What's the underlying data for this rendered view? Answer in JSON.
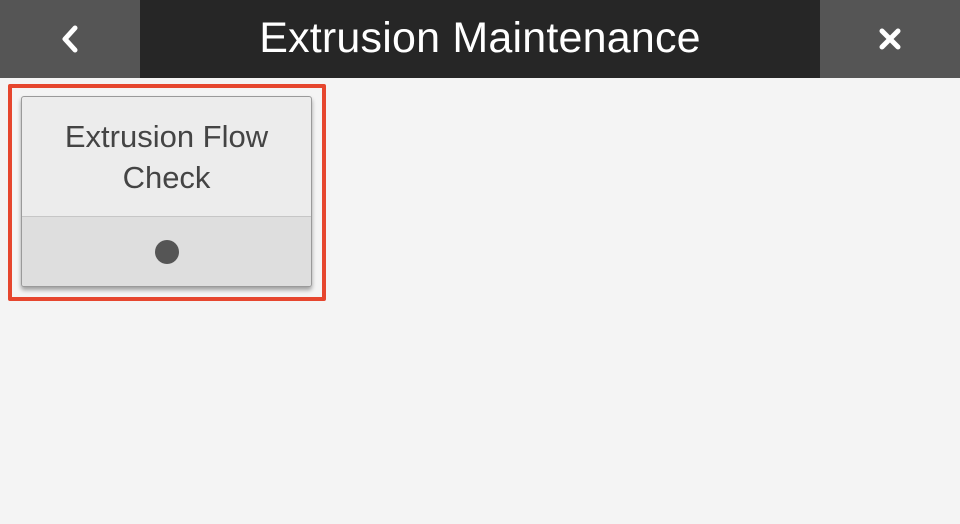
{
  "header": {
    "title": "Extrusion Maintenance",
    "back_icon": "chevron-left-icon",
    "close_icon": "close-icon"
  },
  "tiles": [
    {
      "label": "Extrusion Flow Check",
      "status_icon": "status-dot-icon",
      "highlighted": true
    }
  ],
  "colors": {
    "header_background": "#262626",
    "nav_button_background": "#555555",
    "page_background": "#f4f4f4",
    "highlight_border": "#e6462e",
    "tile_background": "#ececec",
    "tile_status_background": "#dedede",
    "status_dot": "#555555"
  }
}
